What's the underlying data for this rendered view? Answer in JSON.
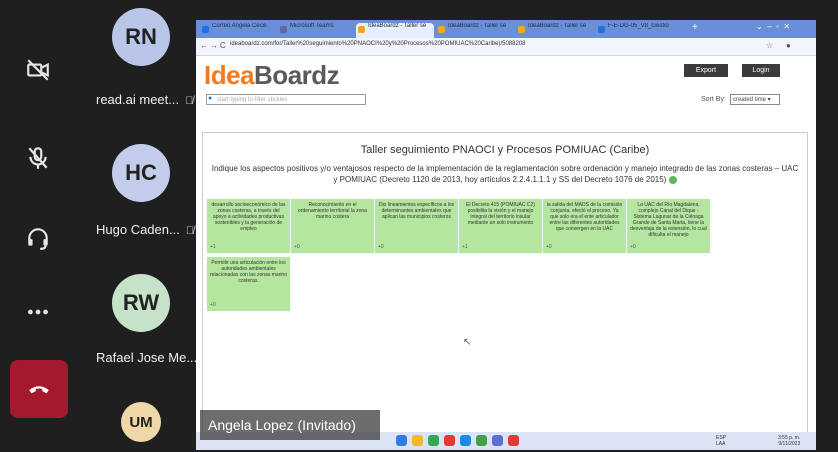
{
  "meeting": {
    "participants": [
      {
        "initials": "RN",
        "name": "read.ai meet...",
        "color": "#b9c6e8"
      },
      {
        "initials": "HC",
        "name": "Hugo Caden...",
        "color": "#c1cdea"
      },
      {
        "initials": "RW",
        "name": "Rafael Jose Me...",
        "color": "#c6e2c8"
      },
      {
        "initials": "UM",
        "name": "",
        "color": "#f0d7a8"
      }
    ],
    "presenter_label": "Angela Lopez (Invitado)"
  },
  "browser": {
    "tabs": [
      {
        "label": "Correo Angela Cecili",
        "color": "#1a73e8"
      },
      {
        "label": "Microsoft Teams",
        "color": "#6264a7"
      },
      {
        "label": "IdeaBoardz - Taller se",
        "color": "#f5a623"
      },
      {
        "label": "IdeaBoardz - Taller se",
        "color": "#f5a623"
      },
      {
        "label": "IdeaBoardz - Taller se",
        "color": "#f5a623"
      },
      {
        "label": "F-E-DG-05_V8_Gestio",
        "color": "#2a6fd6"
      }
    ],
    "url": "ideaboardz.com/for/Taller%20seguimiento%20PNAOCI%20y%20Procesos%20POMIUAC%20Caribe)/5088208"
  },
  "ideaboardz": {
    "logo_idea": "Idea",
    "logo_boardz": "Boardz",
    "export": "Export",
    "login": "Login",
    "filter_placeholder": "start typing to filter stickies",
    "sort_by": "Sort By",
    "sort_value": "created time"
  },
  "board": {
    "title": "Taller seguimiento PNAOCI y Procesos POMIUAC (Caribe)",
    "subtitle": "Indique los aspectos positivos y/o ventajosos respecto de la implementación de la reglamentación sobre ordenación y manejo integrado de las zonas costeras – UAC y POMIUAC (Decreto 1120 de 2013, hoy artículos 2.2.4.1.1.1 y SS del Decreto 1076 de 2015)",
    "stickies": [
      {
        "text": "desarrollo socioeconómico de las zonas costeras, a través del apoyo a actividades productivas sostenibles y la generación de empleo",
        "votes": "+1"
      },
      {
        "text": "Reconocimiento en el ordenamiento territorial la zona marino costera",
        "votes": "+0"
      },
      {
        "text": "Dio lineamientos específicos a los determinantes ambientales que aplican las municipios costeros",
        "votes": "+0"
      },
      {
        "text": "El Decreto 415 (POMIUAC C2) posibilita la visión y el manejo integral del territorio insular mediante un solo instrumento",
        "votes": "+1"
      },
      {
        "text": "la salida del MADS de la comisión conjunta, efectó el proceso. Ya que solo era el ente articulador entre las diferentes autoridades que convergen en la UAC",
        "votes": "+0"
      },
      {
        "text": "La UAC del Río Magdalena, complejo Canal del Dique - Sistema Lagunar de la Ciénaga Grande de Santa Marta, tiene la desventaja de la extensión, lo cual dificulta el manejo",
        "votes": "+0"
      },
      {
        "text": "Permitir una articulación entre los autoridades ambientales relacionadas con las zonas marino costeras.",
        "votes": "+0"
      }
    ]
  },
  "tray": {
    "lang": "ESP\nLAA",
    "time": "3:55 p. m.",
    "date": "9/11/2023"
  }
}
